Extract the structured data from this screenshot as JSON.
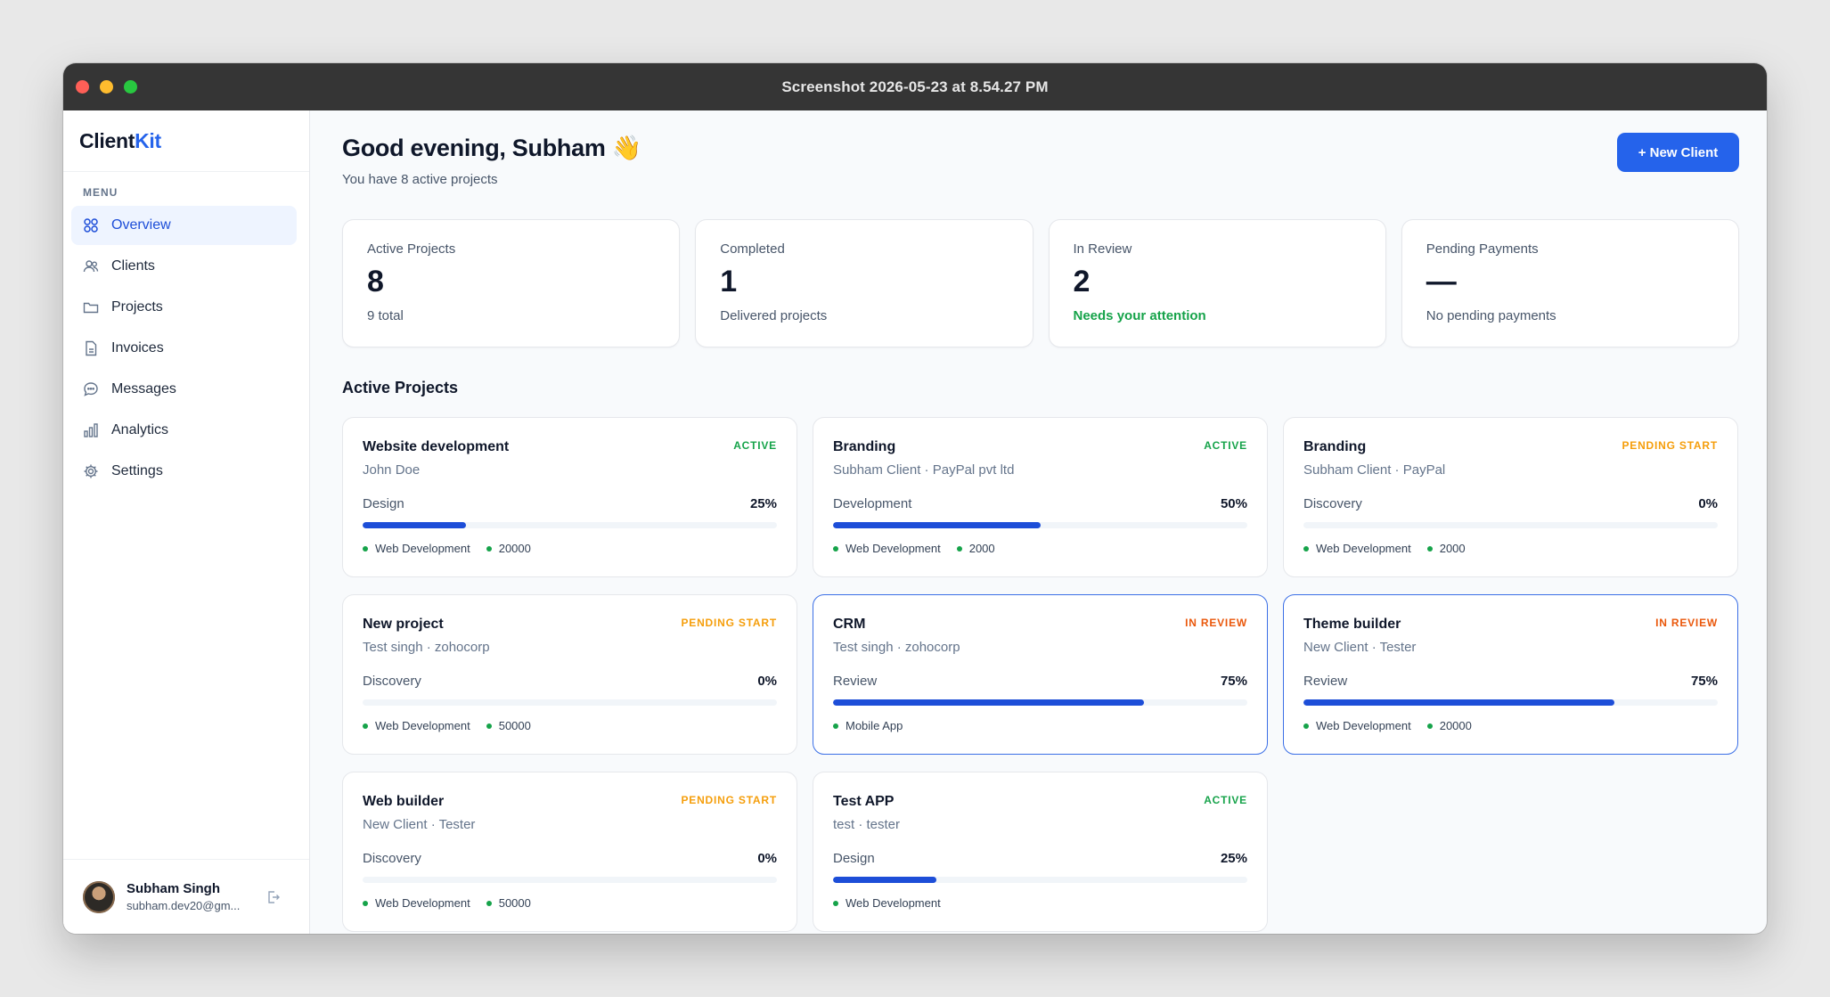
{
  "window": {
    "title": "Screenshot 2026-05-23 at 8.54.27 PM"
  },
  "logo": {
    "part1": "Client",
    "part2": "Kit"
  },
  "sidebar": {
    "menu_label": "MENU",
    "items": [
      {
        "label": "Overview",
        "icon": "grid-icon",
        "active": true
      },
      {
        "label": "Clients",
        "icon": "users-icon",
        "active": false
      },
      {
        "label": "Projects",
        "icon": "folder-icon",
        "active": false
      },
      {
        "label": "Invoices",
        "icon": "file-icon",
        "active": false
      },
      {
        "label": "Messages",
        "icon": "chat-icon",
        "active": false
      },
      {
        "label": "Analytics",
        "icon": "bar-chart-icon",
        "active": false
      },
      {
        "label": "Settings",
        "icon": "gear-icon",
        "active": false
      }
    ],
    "user": {
      "name": "Subham Singh",
      "email": "subham.dev20@gm..."
    }
  },
  "header": {
    "greeting": "Good evening, Subham 👋",
    "subtitle": "You have 8 active projects",
    "new_client_label": "+ New Client"
  },
  "stats": [
    {
      "label": "Active Projects",
      "value": "8",
      "sub": "9 total"
    },
    {
      "label": "Completed",
      "value": "1",
      "sub": "Delivered projects"
    },
    {
      "label": "In Review",
      "value": "2",
      "sub": "Needs your attention"
    },
    {
      "label": "Pending Payments",
      "value": "—",
      "sub": "No pending payments"
    }
  ],
  "section_title": "Active Projects",
  "projects": [
    {
      "title": "Website development",
      "client": "John Doe",
      "status": "ACTIVE",
      "phase": "Design",
      "progress": 25,
      "progress_label": "25%",
      "tags": [
        "Web Development",
        "20000"
      ]
    },
    {
      "title": "Branding",
      "client": "Subham Client · PayPal pvt ltd",
      "status": "ACTIVE",
      "phase": "Development",
      "progress": 50,
      "progress_label": "50%",
      "tags": [
        "Web Development",
        "2000"
      ]
    },
    {
      "title": "Branding",
      "client": "Subham Client · PayPal",
      "status": "PENDING START",
      "phase": "Discovery",
      "progress": 0,
      "progress_label": "0%",
      "tags": [
        "Web Development",
        "2000"
      ]
    },
    {
      "title": "New project",
      "client": "Test singh · zohocorp",
      "status": "PENDING START",
      "phase": "Discovery",
      "progress": 0,
      "progress_label": "0%",
      "tags": [
        "Web Development",
        "50000"
      ]
    },
    {
      "title": "CRM",
      "client": "Test singh · zohocorp",
      "status": "IN REVIEW",
      "phase": "Review",
      "progress": 75,
      "progress_label": "75%",
      "tags": [
        "Mobile App"
      ]
    },
    {
      "title": "Theme builder",
      "client": "New Client · Tester",
      "status": "IN REVIEW",
      "phase": "Review",
      "progress": 75,
      "progress_label": "75%",
      "tags": [
        "Web Development",
        "20000"
      ]
    },
    {
      "title": "Web builder",
      "client": "New Client · Tester",
      "status": "PENDING START",
      "phase": "Discovery",
      "progress": 0,
      "progress_label": "0%",
      "tags": [
        "Web Development",
        "50000"
      ]
    },
    {
      "title": "Test APP",
      "client": "test · tester",
      "status": "ACTIVE",
      "phase": "Design",
      "progress": 25,
      "progress_label": "25%",
      "tags": [
        "Web Development"
      ]
    }
  ],
  "colors": {
    "accent": "#2563eb",
    "active": "#16a34a",
    "pending": "#f59e0b",
    "review": "#ea580c"
  }
}
